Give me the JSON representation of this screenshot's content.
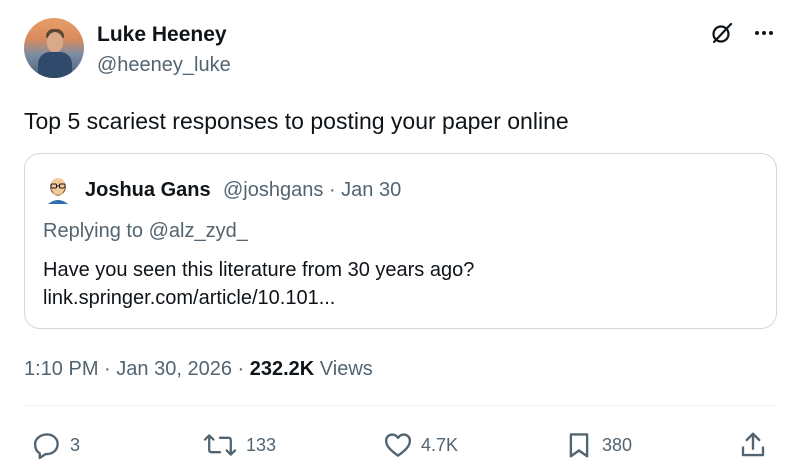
{
  "author": {
    "name": "Luke Heeney",
    "handle": "@heeney_luke"
  },
  "tweet": {
    "text": "Top 5 scariest responses to posting your paper online"
  },
  "quote": {
    "author_name": "Joshua Gans",
    "author_handle": "@joshgans",
    "separator": "·",
    "date": "Jan 30",
    "replying_to": "Replying to @alz_zyd_",
    "text": "Have you seen this literature from 30 years ago?",
    "link": "link.springer.com/article/10.101..."
  },
  "meta": {
    "time": "1:10 PM",
    "separator": "·",
    "date": "Jan 30, 2026",
    "views_count": "232.2K",
    "views_label": "Views"
  },
  "actions": {
    "replies": "3",
    "reposts": "133",
    "likes": "4.7K",
    "bookmarks": "380"
  },
  "icons": {
    "grok": "grok-icon",
    "more": "more-icon",
    "reply": "reply-icon",
    "repost": "repost-icon",
    "like": "heart-icon",
    "bookmark": "bookmark-icon",
    "share": "share-icon"
  },
  "colors": {
    "text": "#0f1419",
    "secondary": "#536471",
    "border": "#cfd9de"
  }
}
